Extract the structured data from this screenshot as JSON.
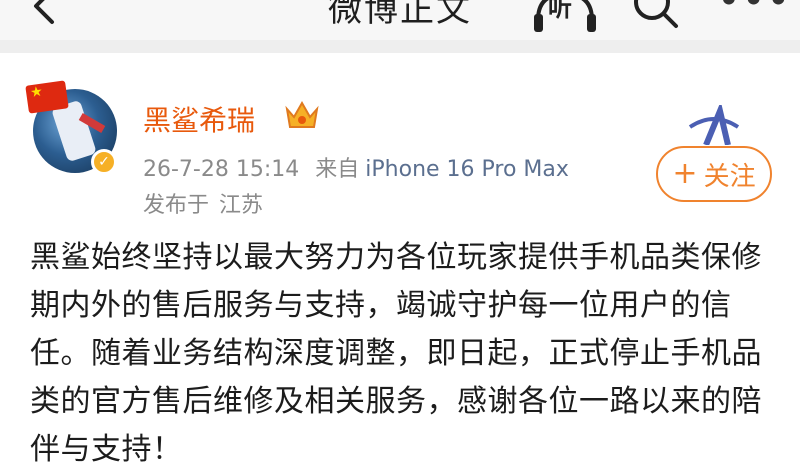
{
  "header": {
    "title": "微博正文",
    "listen_label": "听"
  },
  "post": {
    "author": "黑鲨希瑞",
    "timestamp": "26-7-28 15:14",
    "source_prefix": "来自",
    "device": "iPhone 16 Pro Max",
    "location_label": "发布于",
    "location": "江苏",
    "follow_label": "关注",
    "text": "黑鲨始终坚持以最大努力为各位玩家提供手机品类保修期内外的售后服务与支持，竭诚守护每一位用户的信任。随着业务结构深度调整，即日起，正式停止手机品类的官方售后维修及相关服务，感谢各位一路以来的陪伴与支持！"
  },
  "colors": {
    "username": "#e8590c",
    "follow": "#f0832e",
    "meta": "#8a8a8a",
    "device": "#5b6f8f"
  }
}
